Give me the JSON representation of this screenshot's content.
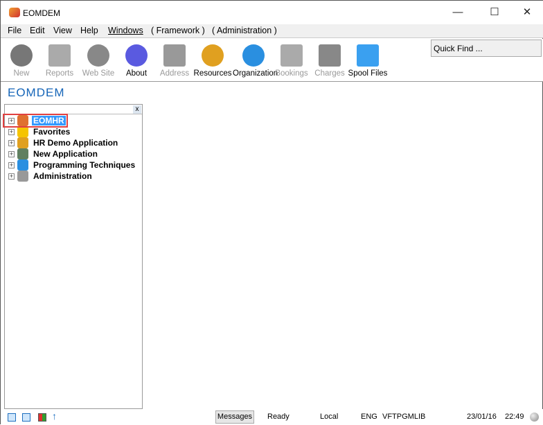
{
  "window": {
    "title": "EOMDEM",
    "minimize": "—",
    "maximize": "☐",
    "close": "✕"
  },
  "menu": [
    "File",
    "Edit",
    "View",
    "Help",
    "Windows",
    "( Framework )",
    "( Administration )"
  ],
  "toolbar": [
    {
      "label": "New",
      "icon": "plus-circle-icon",
      "enabled": false,
      "color": "#777"
    },
    {
      "label": "Reports",
      "icon": "folder-icon",
      "enabled": false,
      "color": "#aaa"
    },
    {
      "label": "Web Site",
      "icon": "globe-icon",
      "enabled": false,
      "color": "#888"
    },
    {
      "label": "About",
      "icon": "about-gear-icon",
      "enabled": true,
      "color": "#5a5ae0"
    },
    {
      "label": "Address",
      "icon": "envelope-icon",
      "enabled": false,
      "color": "#999"
    },
    {
      "label": "Resources",
      "icon": "operator-icon",
      "enabled": true,
      "color": "#e0a020"
    },
    {
      "label": "Organization",
      "icon": "gear-icon",
      "enabled": true,
      "color": "#2a8fe0"
    },
    {
      "label": "Bookings",
      "icon": "clock-document-icon",
      "enabled": false,
      "color": "#aaa"
    },
    {
      "label": "Charges",
      "icon": "coins-icon",
      "enabled": false,
      "color": "#888"
    },
    {
      "label": "Spool Files",
      "icon": "document-icon",
      "enabled": true,
      "color": "#3aa0f0"
    }
  ],
  "quick_find": {
    "placeholder": "Quick Find ..."
  },
  "app_title": "EOMDEM",
  "panel": {
    "close": "x"
  },
  "tree": [
    {
      "label": "EOMHR",
      "icon": "users-icon",
      "selected": true,
      "color": "#e07030"
    },
    {
      "label": "Favorites",
      "icon": "star-icon",
      "color": "#f5c400"
    },
    {
      "label": "HR Demo Application",
      "icon": "person-icon",
      "color": "#e0a020"
    },
    {
      "label": "New Application",
      "icon": "application-icon",
      "color": "#608060"
    },
    {
      "label": "Programming Techniques",
      "icon": "gear-icon",
      "color": "#2a8fe0"
    },
    {
      "label": "Administration",
      "icon": "gears-icon",
      "color": "#999"
    }
  ],
  "status": {
    "messages": "Messages",
    "ready": "Ready",
    "location": "Local",
    "lang": "ENG",
    "library": "VFTPGMLIB",
    "date": "23/01/16",
    "time": "22:49"
  }
}
